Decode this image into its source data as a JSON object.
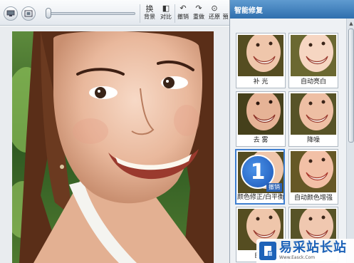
{
  "toolbar": {
    "buttons": [
      {
        "icon": "monitor-icon",
        "label": ""
      },
      {
        "icon": "fit-icon",
        "label": ""
      }
    ],
    "zoom_slider": {
      "value": 0
    },
    "tools": [
      {
        "icon": "换",
        "label": "背景"
      },
      {
        "icon": "◧",
        "label": "对比"
      },
      {
        "icon": "↶",
        "label": "撤销"
      },
      {
        "icon": "↷",
        "label": "重做"
      },
      {
        "icon": "⊙",
        "label": "还原"
      },
      {
        "icon": "",
        "label": "預"
      }
    ]
  },
  "panel": {
    "title": "智能修复",
    "effects": [
      {
        "label": "补 光"
      },
      {
        "label": "自动亮白"
      },
      {
        "label": "去 雾"
      },
      {
        "label": "降噪"
      },
      {
        "label": "颜色修正/白平衡",
        "badge_number": "1",
        "undo_label": "撤销",
        "active": true
      },
      {
        "label": "自动颜色增强"
      },
      {
        "label": "自动"
      },
      {
        "label": ""
      }
    ]
  },
  "watermark": {
    "text": "易采站长站",
    "url": "Www.Easck.Com"
  },
  "colors": {
    "panel_header": "#2f6fae",
    "accent": "#1e63b8"
  }
}
